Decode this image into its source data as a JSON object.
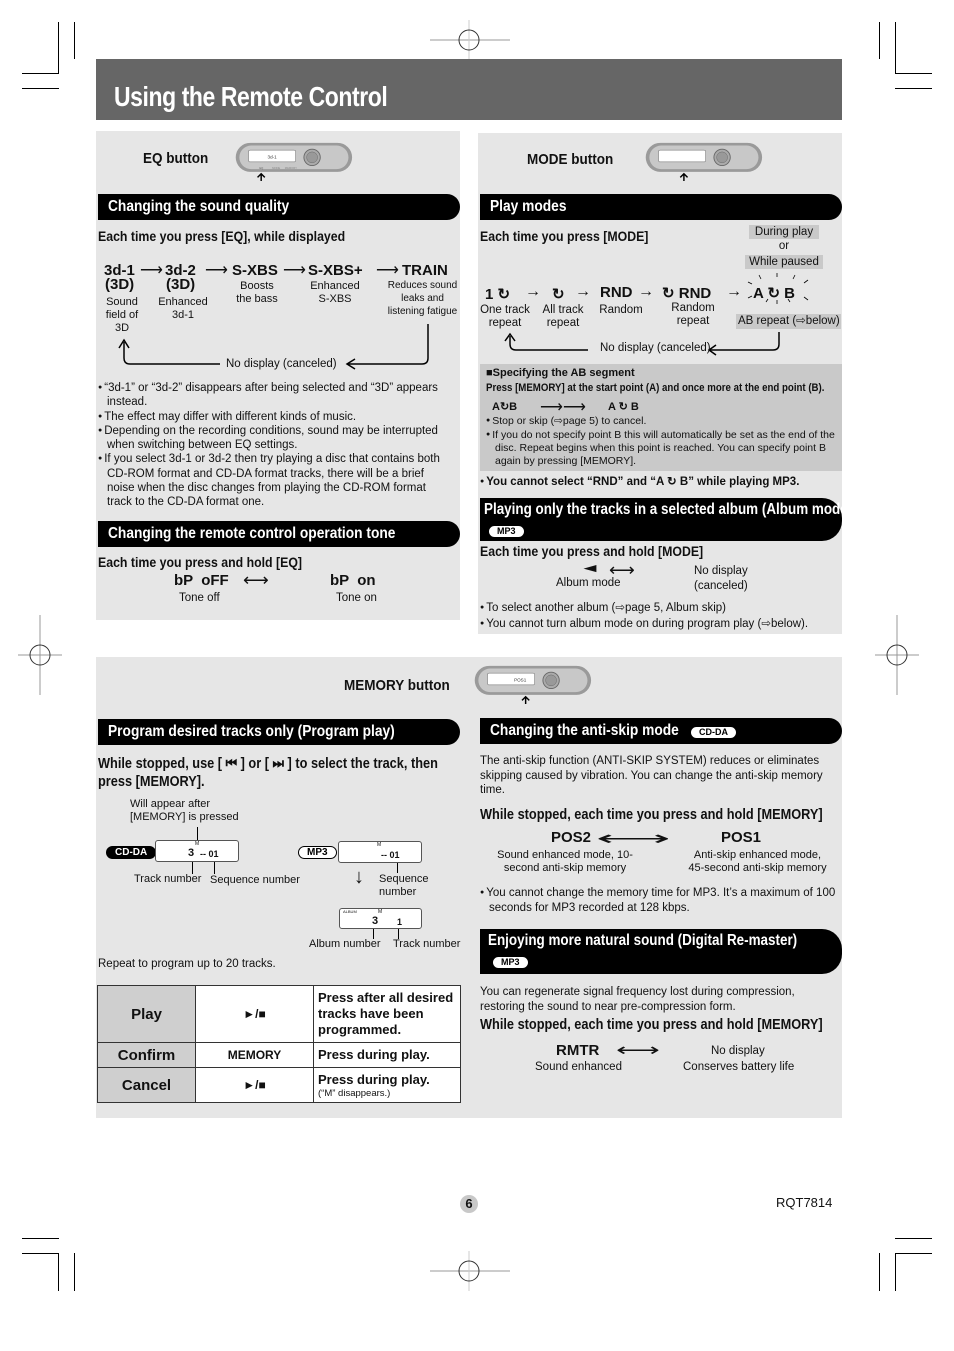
{
  "page": {
    "title": "Using the Remote Control",
    "page_number": "6",
    "doc_code": "RQT7814"
  },
  "eq_section": {
    "button_label": "EQ button",
    "remote_display": "3d-1",
    "remote_buttons": [
      "EQ",
      "MODE",
      "MEMORY"
    ],
    "banner": "Changing the sound quality",
    "instruction": "Each time you press [EQ], while displayed",
    "sequence": [
      {
        "code": "3d-1",
        "sub": "(3D)",
        "desc": "Sound field of 3D"
      },
      {
        "code": "3d-2",
        "sub": "(3D)",
        "desc": "Enhanced 3d-1"
      },
      {
        "code": "S-XBS",
        "sub": "",
        "desc": "Boosts the bass"
      },
      {
        "code": "S-XBS+",
        "sub": "",
        "desc": "Enhanced S-XBS"
      },
      {
        "code": "TRAIN",
        "sub": "",
        "desc": "Reduces sound leaks and listening fatigue"
      }
    ],
    "loop_label": "No display (canceled)",
    "notes": [
      "“3d-1” or “3d-2” disappears after being selected and “3D” appears instead.",
      "The effect may differ with different kinds of music.",
      "Depending on the recording conditions, sound may be interrupted when switching between EQ settings.",
      "If you select 3d-1 or 3d-2 then try playing a disc that contains both CD-ROM format and CD-DA format tracks, there will be a brief noise when the disc changes from playing the CD-ROM format track to the CD-DA format one."
    ]
  },
  "tone_section": {
    "banner": "Changing the remote control operation tone",
    "instruction": "Each time you press and hold [EQ]",
    "left_code": "bP  oFF",
    "left_desc": "Tone off",
    "right_code": "bP  on",
    "right_desc": "Tone on"
  },
  "mode_section": {
    "button_label": "MODE button",
    "banner": "Play modes",
    "instruction": "Each time you press [MODE]",
    "condition_1": "During play",
    "condition_or": "or",
    "condition_2": "While paused",
    "sequence": [
      {
        "code": "1 ↻",
        "desc": "One track repeat"
      },
      {
        "code": "↻",
        "desc": "All track repeat"
      },
      {
        "code": "RND",
        "desc": "Random"
      },
      {
        "code": "↻ RND",
        "desc": "Random repeat"
      },
      {
        "code": "A ↻ B",
        "desc": "AB repeat (⇨below)"
      }
    ],
    "loop_label": "No display (canceled)",
    "ab_box": {
      "heading": "■Specifying the AB segment",
      "instruction": "Press [MEMORY] at the start point (A) and once more at the end point (B).",
      "from": "A↻B",
      "to": "A ↻ B",
      "notes": [
        "Stop or skip (⇨page 5) to cancel.",
        "If you do not specify point B this will automatically be set as the end of the disc. Repeat begins when this point is reached. You can specify point B again by pressing [MEMORY]."
      ]
    },
    "mp3_note": "You cannot select “RND” and “A ↻ B” while playing MP3."
  },
  "album_section": {
    "banner": "Playing only the tracks in a selected album (Album mode)",
    "tag": "MP3",
    "instruction": "Each time you press and hold [MODE]",
    "left_symbol": "◄",
    "left_desc": "Album mode",
    "right_desc": "No display (canceled)",
    "notes": [
      "To select another album (⇨page 5, Album skip)",
      "You cannot turn album mode on during program play (⇨below)."
    ]
  },
  "memory_section": {
    "button_label": "MEMORY button",
    "remote_display": "POS1"
  },
  "program_section": {
    "banner": "Program desired tracks only (Program play)",
    "instruction": "While stopped, use [ ⏮ ] or [ ⏭ ] to select the track, then press [MEMORY].",
    "callout": "Will appear after [MEMORY] is pressed",
    "cdda_tag": "CD-DA",
    "cdda_display_m": "M",
    "cdda_display_track": "3",
    "cdda_display_seq": "-- 01",
    "cdda_label_track": "Track number",
    "cdda_label_seq": "Sequence number",
    "mp3_tag": "MP3",
    "mp3_display_m": "M",
    "mp3_display_seq": "-- 01",
    "mp3_label_seq": "Sequence number",
    "mp3_album_label": "ALBUM",
    "mp3_display2_m": "M",
    "mp3_display2_album": "3",
    "mp3_display2_track": "1",
    "mp3_label_album": "Album number",
    "mp3_label_track": "Track number",
    "repeat_note": "Repeat to program up to 20 tracks.",
    "table": [
      {
        "action": "Play",
        "key": "►/■",
        "desc": "Press after all desired tracks have been programmed.",
        "sub": ""
      },
      {
        "action": "Confirm",
        "key": "MEMORY",
        "desc": "Press during play.",
        "sub": ""
      },
      {
        "action": "Cancel",
        "key": "►/■",
        "desc": "Press during play.",
        "sub": "(“M” disappears.)"
      }
    ]
  },
  "antiskip_section": {
    "banner": "Changing the anti-skip mode",
    "tag": "CD-DA",
    "intro": "The anti-skip function (ANTI-SKIP SYSTEM) reduces or eliminates skipping caused by vibration. You can change the anti-skip memory time.",
    "instruction": "While stopped, each time you press and hold [MEMORY]",
    "left_code": "POS2",
    "left_desc": "Sound enhanced mode, 10-second anti-skip memory",
    "right_code": "POS1",
    "right_desc": "Anti-skip enhanced mode, 45-second anti-skip memory",
    "note": "You cannot change the memory time for MP3. It’s a maximum of 100 seconds for MP3 recorded at 128 kbps."
  },
  "remaster_section": {
    "banner": "Enjoying more natural sound (Digital Re-master)",
    "tag": "MP3",
    "intro": "You can regenerate signal frequency lost during compression, restoring the sound to near pre-compression form.",
    "instruction": "While stopped, each time you press and hold [MEMORY]",
    "left_code": "RMTR",
    "left_desc": "Sound enhanced",
    "right_code": "No display",
    "right_desc": "Conserves battery life"
  }
}
